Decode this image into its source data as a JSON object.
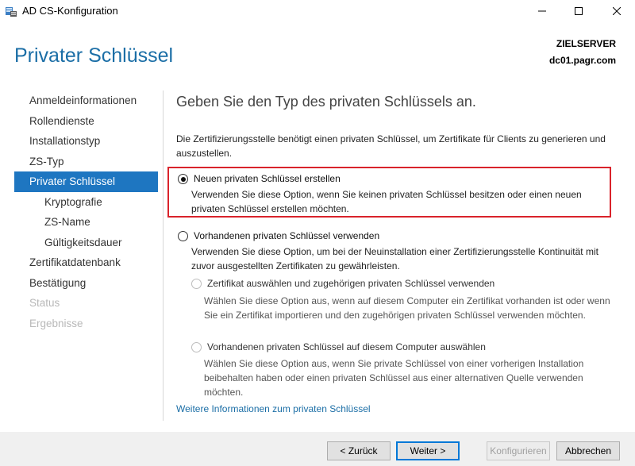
{
  "window": {
    "title": "AD CS-Konfiguration",
    "icon": "server-manager-icon"
  },
  "header": {
    "page_title": "Privater Schlüssel",
    "server_label": "ZIELSERVER",
    "server_name": "dc01.pagr.com"
  },
  "nav": {
    "items": [
      {
        "label": "Anmeldeinformationen",
        "state": "normal"
      },
      {
        "label": "Rollendienste",
        "state": "normal"
      },
      {
        "label": "Installationstyp",
        "state": "normal"
      },
      {
        "label": "ZS-Typ",
        "state": "normal"
      },
      {
        "label": "Privater Schlüssel",
        "state": "active"
      },
      {
        "label": "Kryptografie",
        "state": "sub"
      },
      {
        "label": "ZS-Name",
        "state": "sub"
      },
      {
        "label": "Gültigkeitsdauer",
        "state": "sub"
      },
      {
        "label": "Zertifikatdatenbank",
        "state": "normal"
      },
      {
        "label": "Bestätigung",
        "state": "normal"
      },
      {
        "label": "Status",
        "state": "disabled"
      },
      {
        "label": "Ergebnisse",
        "state": "disabled"
      }
    ]
  },
  "content": {
    "heading": "Geben Sie den Typ des privaten Schlüssels an.",
    "intro": "Die Zertifizierungsstelle benötigt einen privaten Schlüssel, um Zertifikate für Clients zu generieren und auszustellen.",
    "option_new": {
      "label": "Neuen privaten Schlüssel erstellen",
      "description": "Verwenden Sie diese Option, wenn Sie keinen privaten Schlüssel besitzen oder einen neuen privaten Schlüssel erstellen möchten.",
      "selected": true
    },
    "option_existing": {
      "label": "Vorhandenen privaten Schlüssel verwenden",
      "description": "Verwenden Sie diese Option, um bei der Neuinstallation einer Zertifizierungsstelle Kontinuität mit zuvor ausgestellten Zertifikaten zu gewährleisten.",
      "selected": false
    },
    "sub_option_cert": {
      "label": "Zertifikat auswählen und zugehörigen privaten Schlüssel verwenden",
      "description": "Wählen Sie diese Option aus, wenn auf diesem Computer ein Zertifikat vorhanden ist oder wenn Sie ein Zertifikat importieren und den zugehörigen privaten Schlüssel verwenden möchten."
    },
    "sub_option_key": {
      "label": "Vorhandenen privaten Schlüssel auf diesem Computer auswählen",
      "description": "Wählen Sie diese Option aus, wenn Sie private Schlüssel von einer vorherigen Installation beibehalten haben oder einen privaten Schlüssel aus einer alternativen Quelle verwenden möchten."
    },
    "more_info_link": "Weitere Informationen zum privaten Schlüssel"
  },
  "buttons": {
    "back": "< Zurück",
    "next": "Weiter >",
    "configure": "Konfigurieren",
    "cancel": "Abbrechen"
  },
  "colors": {
    "accent": "#1e76c1",
    "title_blue": "#1b6ea6",
    "highlight_red": "#d9232b"
  }
}
